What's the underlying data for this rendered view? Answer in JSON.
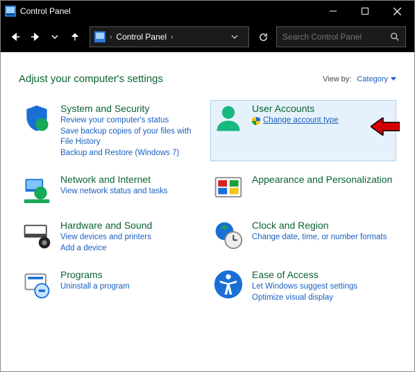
{
  "title": "Control Panel",
  "breadcrumb": {
    "root": "Control Panel"
  },
  "search": {
    "placeholder": "Search Control Panel"
  },
  "heading": "Adjust your computer's settings",
  "viewby": {
    "label": "View by:",
    "mode": "Category"
  },
  "cats": {
    "system": {
      "title": "System and Security",
      "l1": "Review your computer's status",
      "l2": "Save backup copies of your files with File History",
      "l3": "Backup and Restore (Windows 7)"
    },
    "user": {
      "title": "User Accounts",
      "l1": "Change account type"
    },
    "network": {
      "title": "Network and Internet",
      "l1": "View network status and tasks"
    },
    "appearance": {
      "title": "Appearance and Personalization"
    },
    "hardware": {
      "title": "Hardware and Sound",
      "l1": "View devices and printers",
      "l2": "Add a device"
    },
    "clock": {
      "title": "Clock and Region",
      "l1": "Change date, time, or number formats"
    },
    "ease": {
      "title": "Ease of Access",
      "l1": "Let Windows suggest settings",
      "l2": "Optimize visual display"
    },
    "programs": {
      "title": "Programs",
      "l1": "Uninstall a program"
    }
  }
}
